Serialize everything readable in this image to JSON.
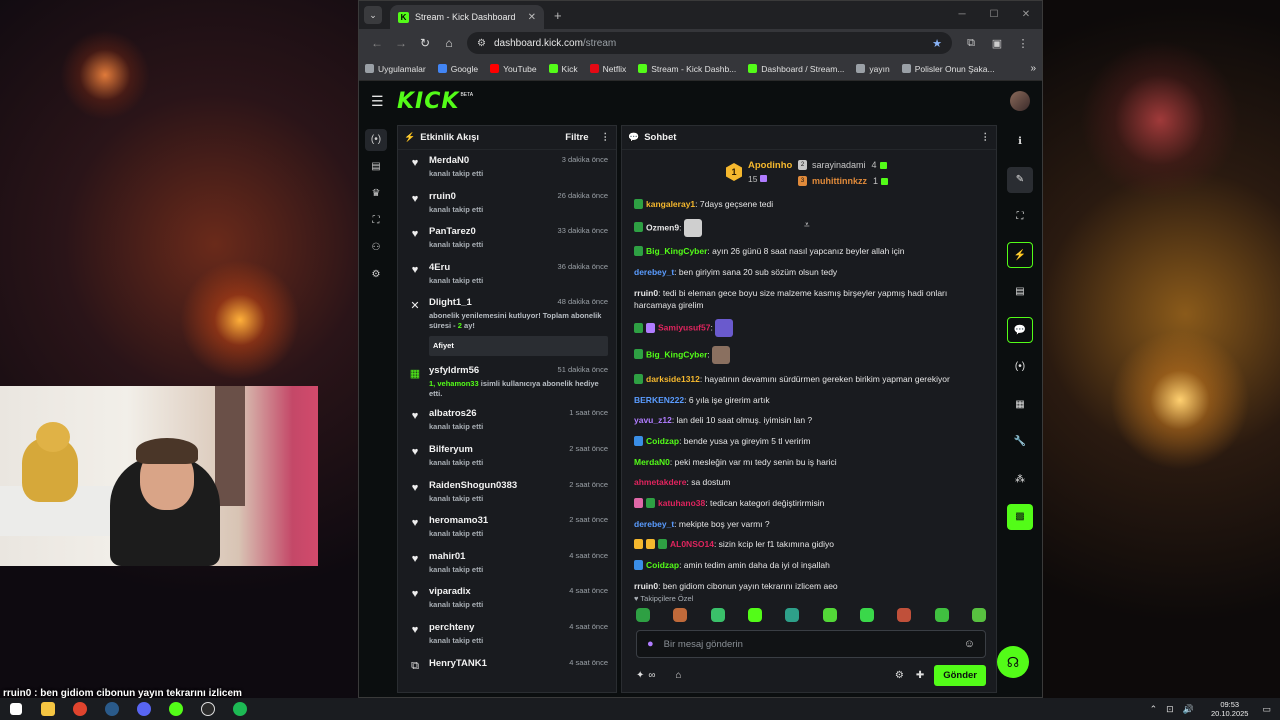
{
  "browser": {
    "tab_title": "Stream - Kick Dashboard",
    "url_host": "dashboard.kick.com",
    "url_path": "/stream",
    "bookmarks": [
      {
        "label": "Uygulamalar",
        "color": "#9aa0a6"
      },
      {
        "label": "Google",
        "color": "#4285f4"
      },
      {
        "label": "YouTube",
        "color": "#ff0000"
      },
      {
        "label": "Kick",
        "color": "#53fc18"
      },
      {
        "label": "Netflix",
        "color": "#e50914"
      },
      {
        "label": "Stream - Kick Dashb...",
        "color": "#53fc18"
      },
      {
        "label": "Dashboard / Stream...",
        "color": "#53fc18"
      },
      {
        "label": "yayın",
        "color": "#9aa0a6"
      },
      {
        "label": "Polisler Onun Şaka...",
        "color": "#9aa0a6"
      }
    ]
  },
  "kick": {
    "logo": "KICK",
    "beta": "BETA"
  },
  "activity": {
    "title": "Etkinlik Akışı",
    "filter_label": "Filtre",
    "events": [
      {
        "icon": "heart-icon",
        "name": "MerdaN0",
        "time": "3 dakika önce",
        "action": "kanalı takip etti"
      },
      {
        "icon": "heart-icon",
        "name": "rruin0",
        "time": "26 dakika önce",
        "action": "kanalı takip etti"
      },
      {
        "icon": "heart-icon",
        "name": "PanTarez0",
        "time": "33 dakika önce",
        "action": "kanalı takip etti"
      },
      {
        "icon": "heart-icon",
        "name": "4Eru",
        "time": "36 dakika önce",
        "action": "kanalı takip etti"
      }
    ],
    "sub_event": {
      "name": "Dlight1_1",
      "time": "48 dakika önce",
      "text": "abonelik yenilemesini kutluyor! Toplam abonelik süresi -",
      "months": "2",
      "unit": "ay!",
      "reply": "Afiyet"
    },
    "gift_event": {
      "name": "ysfyldrm56",
      "time": "51 dakika önce",
      "count": "1,",
      "recipient": "vehamon33",
      "text": "isimli kullanıcıya abonelik hediye etti."
    },
    "events2": [
      {
        "icon": "heart-icon",
        "name": "albatros26",
        "time": "1 saat önce",
        "action": "kanalı takip etti"
      },
      {
        "icon": "heart-icon",
        "name": "Bilferyum",
        "time": "2 saat önce",
        "action": "kanalı takip etti"
      },
      {
        "icon": "heart-icon",
        "name": "RaidenShogun0383",
        "time": "2 saat önce",
        "action": "kanalı takip etti"
      },
      {
        "icon": "heart-icon",
        "name": "heromamo31",
        "time": "2 saat önce",
        "action": "kanalı takip etti"
      },
      {
        "icon": "heart-icon",
        "name": "mahir01",
        "time": "4 saat önce",
        "action": "kanalı takip etti"
      },
      {
        "icon": "heart-icon",
        "name": "viparadix",
        "time": "4 saat önce",
        "action": "kanalı takip etti"
      },
      {
        "icon": "heart-icon",
        "name": "perchteny",
        "time": "4 saat önce",
        "action": "kanalı takip etti"
      },
      {
        "icon": "host-icon",
        "name": "HenryTANK1",
        "time": "4 saat önce",
        "action": ""
      }
    ]
  },
  "chat": {
    "title": "Sohbet",
    "leaders": [
      {
        "rank": "1",
        "name": "Apodinho",
        "count": "15",
        "color": "#f5b82e"
      },
      {
        "rank": "2",
        "name": "sarayinadami",
        "count": "4",
        "color": "#c8c8c8"
      },
      {
        "rank": "3",
        "name": "muhittinnkzz",
        "count": "1",
        "color": "#e08a3a"
      }
    ],
    "messages": [
      {
        "user": "kangaleray1",
        "color": "#f5b82e",
        "badges": [
          "#2ea043"
        ],
        "text": "7days geçsene tedi"
      },
      {
        "user": "Ozmen9",
        "color": "#e6e6e6",
        "badges": [
          "#2ea043"
        ],
        "text": "",
        "emote": "#cfcfcf"
      },
      {
        "user": "Big_KingCyber",
        "color": "#53fc18",
        "badges": [
          "#2ea043"
        ],
        "text": "ayın 26 günü 8 saat nasıl yapcanız beyler allah için"
      },
      {
        "user": "derebey_t",
        "color": "#5a9cff",
        "badges": [],
        "text": "ben giriyim sana 20 sub sözüm olsun tedy"
      },
      {
        "user": "rruin0",
        "color": "#e6e6e6",
        "badges": [],
        "text": "tedi bi eleman gece boyu size malzeme kasmış birşeyler yapmış hadi onları harcamaya girelim"
      },
      {
        "user": "Samiyusuf57",
        "color": "#e0245e",
        "badges": [
          "#2ea043",
          "#b07cff"
        ],
        "text": "",
        "emote": "#6a5acd"
      },
      {
        "user": "Big_KingCyber",
        "color": "#53fc18",
        "badges": [
          "#2ea043"
        ],
        "text": "",
        "emote": "#8a7060"
      },
      {
        "user": "darkside1312",
        "color": "#f5b82e",
        "badges": [
          "#2ea043"
        ],
        "text": "hayatının devamını sürdürmen gereken birikim yapman gerekiyor"
      },
      {
        "user": "BERKEN222",
        "color": "#5a9cff",
        "badges": [],
        "text": "6 yıla işe girerim artık"
      },
      {
        "user": "yavu_z12",
        "color": "#b07cff",
        "badges": [],
        "text": "lan deli 10 saat olmuş. iyimisin lan ?"
      },
      {
        "user": "Coidzap",
        "color": "#53fc18",
        "badges": [
          "#3a8ee6"
        ],
        "text": "bende yusa ya gireyim 5 tl veririm"
      },
      {
        "user": "MerdaN0",
        "color": "#53fc18",
        "badges": [],
        "text": "peki mesleğin var mı tedy senin bu iş harici"
      },
      {
        "user": "ahmetakdere",
        "color": "#e0245e",
        "badges": [],
        "text": "sa dostum"
      },
      {
        "user": "katuhano38",
        "color": "#e0245e",
        "badges": [
          "#e068a8",
          "#2ea043"
        ],
        "text": "tedican kategori değiştirirmisin"
      },
      {
        "user": "derebey_t",
        "color": "#5a9cff",
        "badges": [],
        "text": "mekipte boş yer varmı ?"
      },
      {
        "user": "AL0NSO14",
        "color": "#e0245e",
        "badges": [
          "#f5b82e",
          "#f5b82e",
          "#2ea043"
        ],
        "text": "sizin kcip ler f1 takımına gidiyo"
      },
      {
        "user": "Coidzap",
        "color": "#53fc18",
        "badges": [
          "#3a8ee6"
        ],
        "text": "amin tedim amin daha da iyi ol inşallah"
      },
      {
        "user": "rruin0",
        "color": "#e6e6e6",
        "badges": [],
        "text": "ben gidiom cibonun yayın tekrarını izlicem aeo"
      }
    ],
    "followers_only": "Takipçilere Özel",
    "input_placeholder": "Bir mesaj gönderin",
    "send_label": "Gönder"
  },
  "overlay": {
    "bottom_message": "rruin0 : ben gidiom cibonun yayın tekrarını izlicem"
  },
  "taskbar": {
    "time": "09:53",
    "date": "20.10.2025"
  }
}
